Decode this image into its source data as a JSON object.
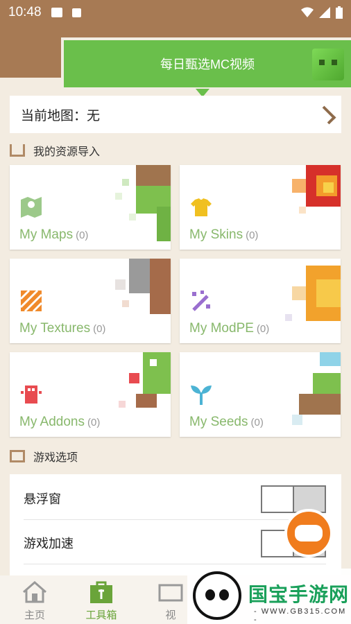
{
  "status_bar": {
    "time": "10:48",
    "icons": [
      "image-icon",
      "a-icon",
      "wifi-icon",
      "signal-icon",
      "battery-icon"
    ]
  },
  "banner": {
    "text": "每日甄选MC视频",
    "icon": "slime-icon",
    "color": "#6abf4b"
  },
  "current_map": {
    "label": "当前地图：",
    "value": "无"
  },
  "sections": {
    "import": "我的资源导入",
    "game_options": "游戏选项"
  },
  "cards": [
    {
      "label": "My Maps",
      "count": "(0)",
      "icon": "map-icon"
    },
    {
      "label": "My Skins",
      "count": "(0)",
      "icon": "shirt-icon"
    },
    {
      "label": "My Textures",
      "count": "(0)",
      "icon": "texture-icon"
    },
    {
      "label": "My ModPE",
      "count": "(0)",
      "icon": "magic-wand-icon"
    },
    {
      "label": "My Addons",
      "count": "(0)",
      "icon": "addon-icon"
    },
    {
      "label": "My Seeds",
      "count": "(0)",
      "icon": "sprout-icon"
    }
  ],
  "options": [
    {
      "label": "悬浮窗",
      "enabled": false
    },
    {
      "label": "游戏加速",
      "enabled": false
    }
  ],
  "nav": [
    {
      "label": "主页",
      "icon": "home-icon",
      "active": false
    },
    {
      "label": "工具箱",
      "icon": "toolbox-icon",
      "active": true
    },
    {
      "label": "视",
      "icon": "video-icon",
      "active": false
    }
  ],
  "watermark": {
    "title": "国宝手游网",
    "subtitle": "- WWW.GB315.COM -"
  },
  "colors": {
    "header": "#a77a54",
    "accent_green": "#6abf4b",
    "card_label": "#88b86c",
    "fab": "#f07c1d"
  }
}
